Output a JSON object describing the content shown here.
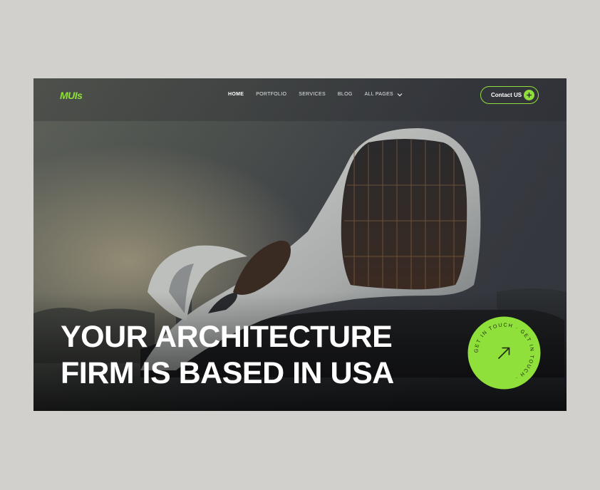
{
  "brand": {
    "logo_text": "MUIs",
    "accent_color": "#8fe03a"
  },
  "nav": {
    "items": [
      {
        "label": "HOME",
        "active": true
      },
      {
        "label": "PORTFOLIO",
        "active": false
      },
      {
        "label": "SERVICES",
        "active": false
      },
      {
        "label": "BLOG",
        "active": false
      },
      {
        "label": "ALL PAGES",
        "active": false,
        "icon": "chevron-down-icon"
      }
    ],
    "contact_label": "Contact US",
    "contact_icon": "plus-icon"
  },
  "hero": {
    "headline_line1": "YOUR ARCHITECTURE",
    "headline_line2": "FIRM IS BASED IN USA",
    "background": "futuristic curved white building with dark glass facade under cloudy sky"
  },
  "badge": {
    "ring_text": "GET IN TOUCH · GET IN TOUCH · ",
    "icon": "arrow-up-right-icon"
  }
}
